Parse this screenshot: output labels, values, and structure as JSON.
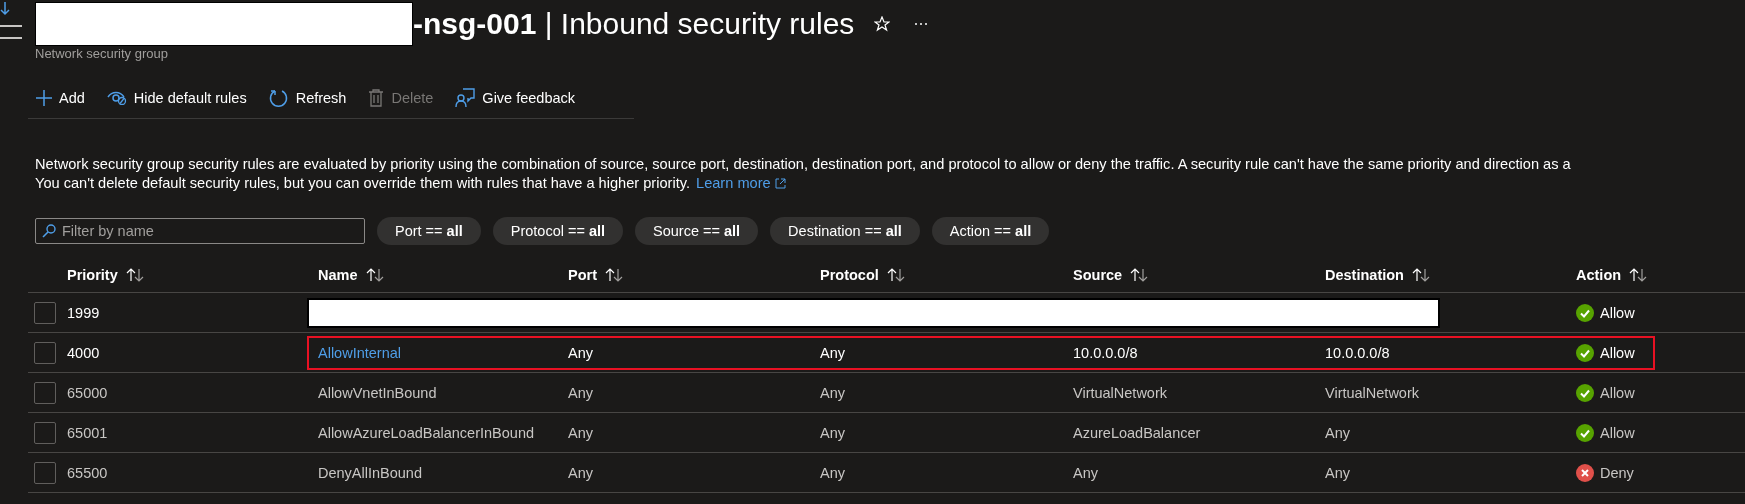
{
  "header": {
    "title": "**-nsg-001** | Inbound security rules",
    "title_redacted": true,
    "subtitle": "Network security group"
  },
  "toolbar": [
    {
      "kind": "add",
      "label": "Add",
      "disabled": false
    },
    {
      "kind": "hide",
      "label": "Hide default rules",
      "disabled": false
    },
    {
      "kind": "refresh",
      "label": "Refresh",
      "disabled": false
    },
    {
      "kind": "delete",
      "label": "Delete",
      "disabled": true
    },
    {
      "kind": "feedback",
      "label": "Give feedback",
      "disabled": false
    }
  ],
  "description": {
    "line_1": "Network security group security rules are evaluated by priority using the combination of source, source port, destination, destination port, and protocol to allow or deny the traffic. A security rule can't have the same priority and direction as a",
    "line_2": "You can't delete default security rules, but you can override them with rules that have a higher priority.",
    "link": "Learn more"
  },
  "filter": {
    "placeholder": "Filter by name"
  },
  "filter_pills": [
    "Port == **all**",
    "Protocol == **all**",
    "Source == **all**",
    "Destination == **all**",
    "Action == **all**"
  ],
  "table": {
    "columns": [
      "Priority",
      "Name",
      "Port",
      "Protocol",
      "Source",
      "Destination",
      "Action"
    ],
    "rows": [
      {
        "priority": "1999",
        "redacted": true,
        "highlighted": false,
        "kind": "custom",
        "checked": false,
        "action": {
          "kind": "allow",
          "label": "Allow"
        }
      },
      {
        "priority": "4000",
        "name": "AllowInternal",
        "port": "Any",
        "protocol": "Any",
        "source": "10.0.0.0/8",
        "destination": "10.0.0.0/8",
        "redacted": false,
        "highlighted": true,
        "kind": "custom",
        "checked": false,
        "action": {
          "kind": "allow",
          "label": "Allow"
        }
      },
      {
        "priority": "65000",
        "name": "AllowVnetInBound",
        "port": "Any",
        "protocol": "Any",
        "source": "VirtualNetwork",
        "destination": "VirtualNetwork",
        "redacted": false,
        "highlighted": false,
        "kind": "default",
        "checked": false,
        "action": {
          "kind": "allow",
          "label": "Allow"
        }
      },
      {
        "priority": "65001",
        "name": "AllowAzureLoadBalancerInBound",
        "port": "Any",
        "protocol": "Any",
        "source": "AzureLoadBalancer",
        "destination": "Any",
        "redacted": false,
        "highlighted": false,
        "kind": "default",
        "checked": false,
        "action": {
          "kind": "allow",
          "label": "Allow"
        }
      },
      {
        "priority": "65500",
        "name": "DenyAllInBound",
        "port": "Any",
        "protocol": "Any",
        "source": "Any",
        "destination": "Any",
        "redacted": false,
        "highlighted": false,
        "kind": "default",
        "checked": false,
        "action": {
          "kind": "deny",
          "label": "Deny"
        }
      }
    ]
  }
}
